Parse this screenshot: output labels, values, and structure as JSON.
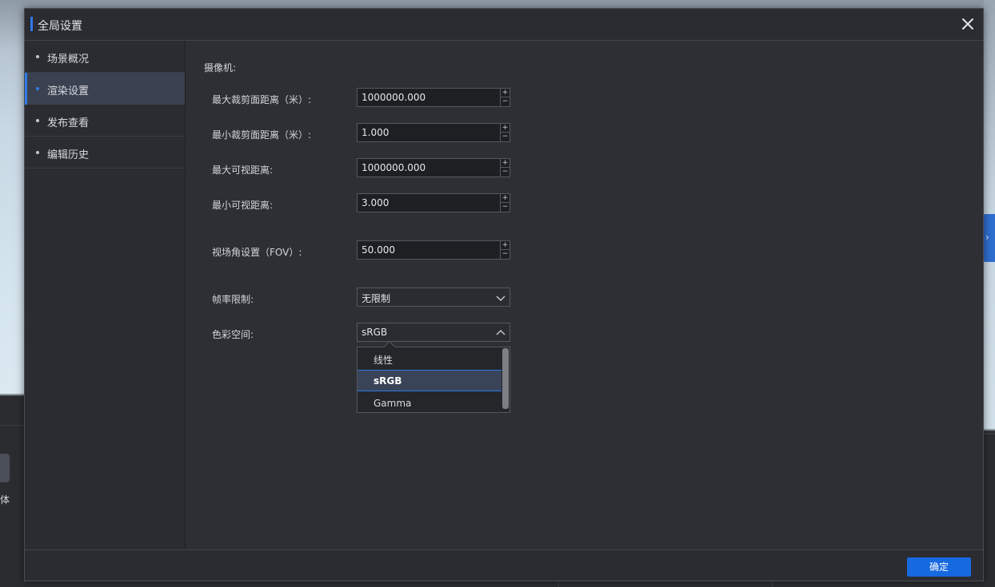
{
  "background": {
    "left_panel_label": "刚体",
    "collapse_icon": "chevron-right-icon"
  },
  "dialog": {
    "title": "全局设置",
    "close_icon": "close-icon"
  },
  "sidebar": {
    "items": [
      {
        "label": "场景概况",
        "active": false
      },
      {
        "label": "渲染设置",
        "active": true
      },
      {
        "label": "发布查看",
        "active": false
      },
      {
        "label": "编辑历史",
        "active": false
      }
    ]
  },
  "content": {
    "section_title": "摄像机:",
    "fields": {
      "max_clip": {
        "label": "最大裁剪面距离（米）:",
        "value": "1000000.000"
      },
      "min_clip": {
        "label": "最小裁剪面距离（米）:",
        "value": "1.000"
      },
      "max_view": {
        "label": "最大可视距离:",
        "value": "1000000.000"
      },
      "min_view": {
        "label": "最小可视距离:",
        "value": "3.000"
      },
      "fov": {
        "label": "视场角设置（FOV）:",
        "value": "50.000"
      },
      "frame_rate": {
        "label": "帧率限制:",
        "value": "无限制"
      },
      "color_space": {
        "label": "色彩空间:",
        "value": "sRGB"
      }
    },
    "stepper": {
      "up": "+",
      "down": "−"
    },
    "color_space_options": [
      "线性",
      "sRGB",
      "Gamma"
    ],
    "color_space_selected_index": 1
  },
  "footer": {
    "ok_label": "确定"
  },
  "colors": {
    "accent": "#2f7ae6",
    "button": "#1769e0",
    "dialog_bg": "#2e2f34",
    "sidebar_active": "#3a4150"
  }
}
